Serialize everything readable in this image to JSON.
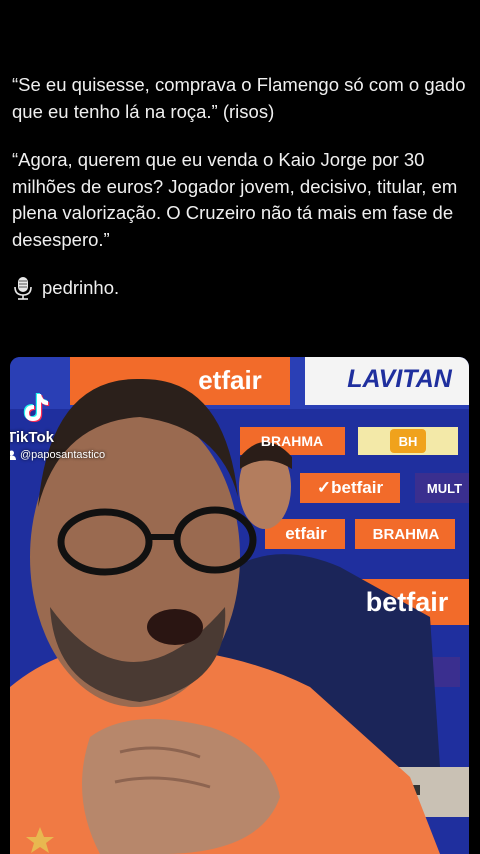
{
  "post": {
    "paragraph_1": "“Se eu quisesse, comprava o Flamengo só com o gado que eu tenho lá na roça.” (risos)",
    "paragraph_2": "“Agora, querem que eu venda o Kaio Jorge por 30 milhões de euros? Jogador jovem, decisivo, titular, em plena valorização. O Cruzeiro não tá mais em fase de desespero.”",
    "signature": "pedrinho."
  },
  "video": {
    "sponsors": {
      "betfair_top": "etfair",
      "lavitan": "LAVITAN",
      "brahma_1": "BRAHMA",
      "bh": "BH",
      "betfair_mid": "✓betfair",
      "multi": "MULT",
      "betfair_low": "etfair",
      "brahma_2": "BRAHMA",
      "betfair_right": "betfair"
    },
    "tiktok": {
      "name": "TikTok",
      "handle": "@paposantastico"
    }
  },
  "colors": {
    "background": "#000000",
    "board_blue": "#1f2f9e",
    "betfair_orange": "#f26b2a",
    "shirt_orange": "#f07a44"
  },
  "icons": {
    "signature": "microphone-icon",
    "tiktok": "tiktok-logo-icon",
    "handle": "user-icon"
  }
}
